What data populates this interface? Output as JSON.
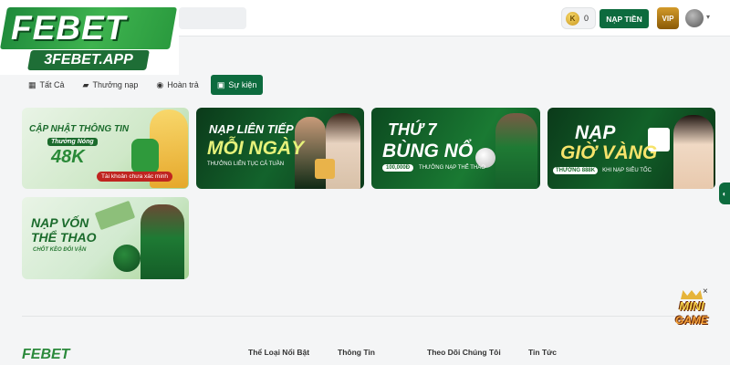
{
  "brand": {
    "logo_main": "FEBET",
    "logo_sub": "3FEBET.APP"
  },
  "header": {
    "coin_symbol": "K",
    "balance": "0",
    "deposit_label": "NẠP TIỀN",
    "vip_label": "VIP"
  },
  "tabs": [
    {
      "label": "Tất Cả",
      "icon": "grid-icon"
    },
    {
      "label": "Thưởng nạp",
      "icon": "wallet-icon"
    },
    {
      "label": "Hoàn trả",
      "icon": "refund-icon"
    },
    {
      "label": "Sự kiện",
      "icon": "event-icon",
      "active": true
    }
  ],
  "promos": [
    {
      "line1": "CẬP NHẬT THÔNG TIN",
      "line2": "Thưởng Nóng",
      "line3": "48K",
      "line4": "Tài khoản chưa xác minh"
    },
    {
      "line1": "NẠP LIÊN TIẾP",
      "line2": "MỖI NGÀY",
      "line3": "THƯỞNG LIÊN TỤC CẢ TUẦN"
    },
    {
      "line1": "THỨ 7",
      "line2": "BÙNG NỔ",
      "pill": "100,000Đ",
      "line3": "THƯỞNG NẠP THỂ THAO"
    },
    {
      "line1": "NẠP",
      "line2": "GIỜ VÀNG",
      "pill": "THƯỞNG 888K",
      "line3": "KHI NẠP SIÊU TỐC"
    },
    {
      "line1": "NẠP VỐN",
      "line2": "THỂ THAO",
      "line3": "CHỐT KÈO ĐỔI VẬN"
    }
  ],
  "footer": {
    "logo": "FEBET",
    "columns": [
      "Thể Loại Nổi Bật",
      "Thông Tin",
      "Theo Dõi Chúng Tôi",
      "Tin Tức"
    ]
  },
  "mini_game": {
    "line1": "MINI",
    "line2": "GAME",
    "close": "×"
  }
}
